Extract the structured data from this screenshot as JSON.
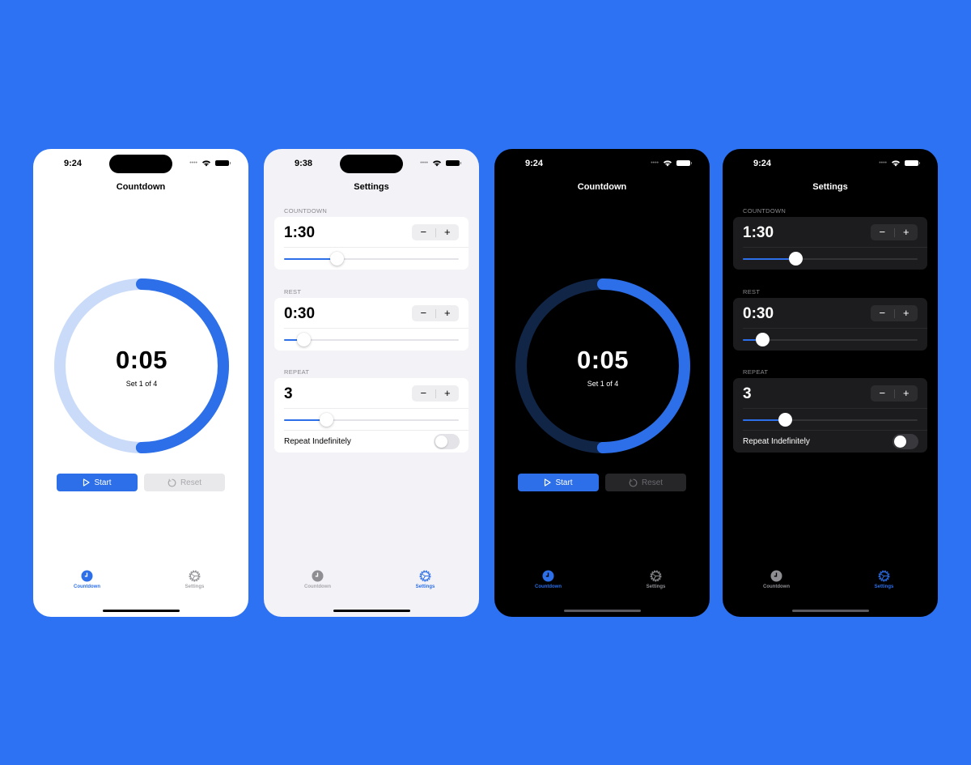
{
  "colors": {
    "background": "#2c72f3",
    "accent": "#2c6fe8",
    "ring_track_light": "#c9dbf8",
    "ring_track_dark": "#112547",
    "tab_inactive": "#8e8e93"
  },
  "screens": [
    {
      "theme": "light",
      "status": {
        "time": "9:24"
      },
      "nav_title": "Countdown",
      "timer": {
        "display": "0:05",
        "set_label": "Set 1 of 4",
        "progress_remaining": 0.5
      },
      "buttons": {
        "start": "Start",
        "reset": "Reset"
      },
      "tabs": [
        {
          "label": "Countdown",
          "icon": "clock-icon",
          "active": true
        },
        {
          "label": "Settings",
          "icon": "gear-icon",
          "active": false
        }
      ]
    },
    {
      "theme": "light",
      "status": {
        "time": "9:38"
      },
      "nav_title": "Settings",
      "sections": [
        {
          "header": "COUNTDOWN",
          "value": "1:30",
          "slider": 0.3
        },
        {
          "header": "REST",
          "value": "0:30",
          "slider": 0.11
        },
        {
          "header": "REPEAT",
          "value": "3",
          "slider": 0.24,
          "toggle_label": "Repeat Indefinitely",
          "toggle_on": false
        }
      ],
      "stepper": {
        "minus": "−",
        "plus": "+"
      },
      "tabs": [
        {
          "label": "Countdown",
          "icon": "clock-icon",
          "active": false
        },
        {
          "label": "Settings",
          "icon": "gear-icon",
          "active": true
        }
      ]
    },
    {
      "theme": "dark",
      "status": {
        "time": "9:24"
      },
      "nav_title": "Countdown",
      "timer": {
        "display": "0:05",
        "set_label": "Set 1 of 4",
        "progress_remaining": 0.5
      },
      "buttons": {
        "start": "Start",
        "reset": "Reset"
      },
      "tabs": [
        {
          "label": "Countdown",
          "icon": "clock-icon",
          "active": true
        },
        {
          "label": "Settings",
          "icon": "gear-icon",
          "active": false
        }
      ]
    },
    {
      "theme": "dark",
      "status": {
        "time": "9:24"
      },
      "nav_title": "Settings",
      "sections": [
        {
          "header": "COUNTDOWN",
          "value": "1:30",
          "slider": 0.3
        },
        {
          "header": "REST",
          "value": "0:30",
          "slider": 0.11
        },
        {
          "header": "REPEAT",
          "value": "3",
          "slider": 0.24,
          "toggle_label": "Repeat Indefinitely",
          "toggle_on": false
        }
      ],
      "stepper": {
        "minus": "−",
        "plus": "+"
      },
      "tabs": [
        {
          "label": "Countdown",
          "icon": "clock-icon",
          "active": false
        },
        {
          "label": "Settings",
          "icon": "gear-icon",
          "active": true
        }
      ]
    }
  ]
}
